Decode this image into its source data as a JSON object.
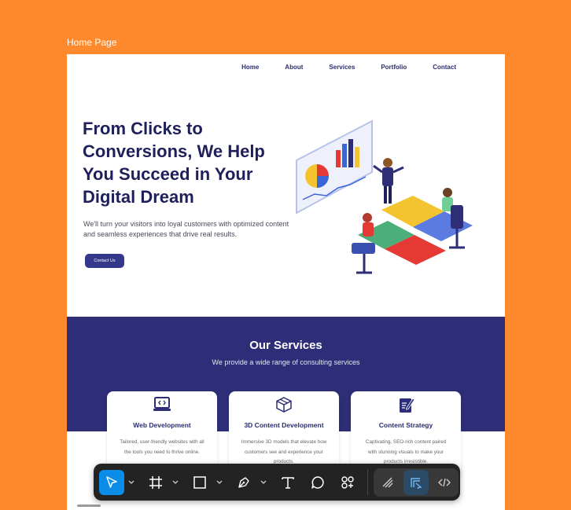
{
  "frame": {
    "label": "Home Page"
  },
  "nav": {
    "items": [
      "Home",
      "About",
      "Services",
      "Portfolio",
      "Contact"
    ]
  },
  "hero": {
    "title": "From Clicks to Conversions, We Help You Succeed in Your Digital Dream",
    "subtitle": "We'll turn your visitors into loyal customers with optimized content and seamless experiences that drive real results.",
    "cta_label": "Contact Us"
  },
  "services": {
    "title": "Our Services",
    "subtitle": "We provide a wide range of consulting services",
    "cards": [
      {
        "icon": "laptop-code-icon",
        "title": "Web Development",
        "text": "Tailored, user-friendly websites with all the tools you need to thrive online."
      },
      {
        "icon": "cube-icon",
        "title": "3D Content Development",
        "text": "Immersive 3D models that elevate how customers see and experience your products."
      },
      {
        "icon": "edit-document-icon",
        "title": "Content Strategy",
        "text": "Captivating, SEO-rich content paired with stunning visuals to make your products irresistible."
      }
    ]
  },
  "toolbar": {
    "tools": [
      "move-icon",
      "frame-icon",
      "rectangle-icon",
      "pen-icon",
      "text-icon",
      "comment-icon",
      "actions-icon"
    ],
    "modes": [
      "draw-mode-icon",
      "design-mode-icon",
      "dev-mode-icon"
    ],
    "accent": "#0C8CE9"
  },
  "colors": {
    "background": "#FF8A2E",
    "brand": "#2E2E78",
    "heading": "#1F1F5C"
  }
}
